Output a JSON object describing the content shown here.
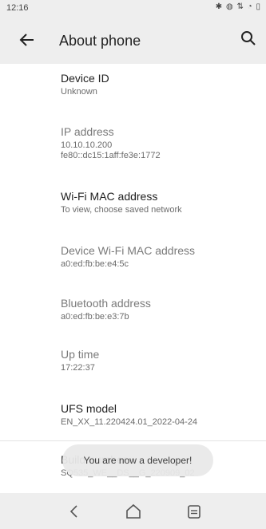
{
  "status_bar": {
    "time": "12:16"
  },
  "app_bar": {
    "title": "About phone"
  },
  "items": [
    {
      "title": "Device ID",
      "subtitle": "Unknown"
    },
    {
      "title": "IP address",
      "subtitle": "10.10.10.200",
      "subtitle2": "fe80::dc15:1aff:fe3e:1772"
    },
    {
      "title": "Wi-Fi MAC address",
      "subtitle": "To view, choose saved network"
    },
    {
      "title": "Device Wi-Fi MAC address",
      "subtitle": "a0:ed:fb:be:e4:5c"
    },
    {
      "title": "Bluetooth address",
      "subtitle": "a0:ed:fb:be:e3:7b"
    },
    {
      "title": "Up time",
      "subtitle": "17:22:37"
    },
    {
      "title": "UFS model",
      "subtitle": "EN_XX_11.220424.01_2022-04-24"
    },
    {
      "title": "Build number",
      "subtitle": "SQ535_WE__DS__G_220909_02"
    }
  ],
  "toast": {
    "text": "You are now a developer!"
  },
  "icons": {
    "status": [
      "bluetooth-icon",
      "vibrate-icon",
      "data-icon",
      "wifi-icon",
      "battery-icon"
    ],
    "app_bar": [
      "back-arrow-icon",
      "search-icon"
    ],
    "nav": [
      "back-icon",
      "home-icon",
      "recents-icon"
    ]
  }
}
